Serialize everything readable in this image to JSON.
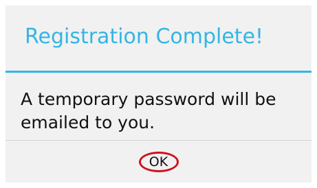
{
  "dialog": {
    "title": "Registration Complete!",
    "message": "A temporary password will be emailed to you.",
    "ok_label": "OK"
  },
  "colors": {
    "accent": "#33b5e5",
    "background": "#f1f1f1",
    "highlight_ring": "#d0111e"
  }
}
